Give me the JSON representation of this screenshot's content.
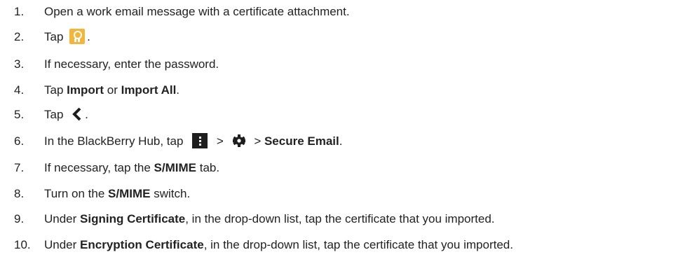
{
  "steps": [
    {
      "num": "1.",
      "text": "Open a work email message with a certificate attachment."
    },
    {
      "num": "2.",
      "pre": "Tap",
      "post": ".",
      "icon": "certificate-icon"
    },
    {
      "num": "3.",
      "text": "If necessary, enter the password."
    },
    {
      "num": "4.",
      "pre": "Tap ",
      "bold1": "Import",
      "mid": " or ",
      "bold2": "Import All",
      "post": "."
    },
    {
      "num": "5.",
      "pre": "Tap",
      "post": ".",
      "icon": "back-chevron-icon"
    },
    {
      "num": "6.",
      "pre": "In the BlackBerry Hub, tap",
      "sep1": ">",
      "sep2": "> ",
      "bold": "Secure Email",
      "post": ".",
      "icons": [
        "overflow-menu-icon",
        "settings-gear-icon"
      ]
    },
    {
      "num": "7.",
      "pre": "If necessary, tap the ",
      "bold": "S/MIME",
      "post": " tab."
    },
    {
      "num": "8.",
      "pre": "Turn on the ",
      "bold": "S/MIME",
      "post": " switch."
    },
    {
      "num": "9.",
      "pre": "Under ",
      "bold": "Signing Certificate",
      "post": ", in the drop-down list, tap the certificate that you imported."
    },
    {
      "num": "10.",
      "pre": "Under ",
      "bold": "Encryption Certificate",
      "post": ", in the drop-down list, tap the certificate that you imported."
    }
  ],
  "colors": {
    "text": "#222222",
    "certificate_icon_bg": "#f3b63a",
    "menu_icon_bg": "#1e1e1e"
  }
}
